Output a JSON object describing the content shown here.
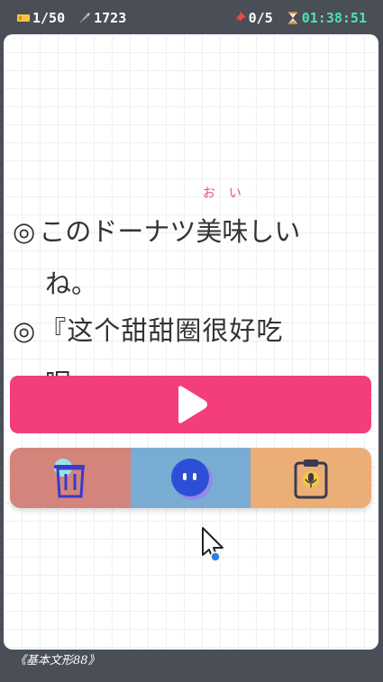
{
  "status": {
    "tickets": "1/50",
    "rockets": "1723",
    "pins": "0/5",
    "timer": "01:38:51"
  },
  "sentence_jp": {
    "bullet": "◎",
    "before": "このドーナツ",
    "kanji1": "美",
    "ruby1": "お",
    "kanji2": "味",
    "ruby2": "い",
    "after": "しい",
    "line2": "ね。"
  },
  "sentence_cn": {
    "bullet": "◎",
    "line1": "『这个甜甜圈很好吃",
    "line2": "呢。』"
  },
  "footer": {
    "label": "《基本文形88》"
  },
  "colors": {
    "accent_pink": "#f33d7c",
    "delete": "#d3857b",
    "middle": "#79acd3",
    "clipboard": "#ebae77",
    "timer": "#4de3b0"
  },
  "icons": {
    "play": "play-icon",
    "delete": "trash-icon",
    "middle": "blob-face-icon",
    "clipboard": "clipboard-mic-icon"
  }
}
